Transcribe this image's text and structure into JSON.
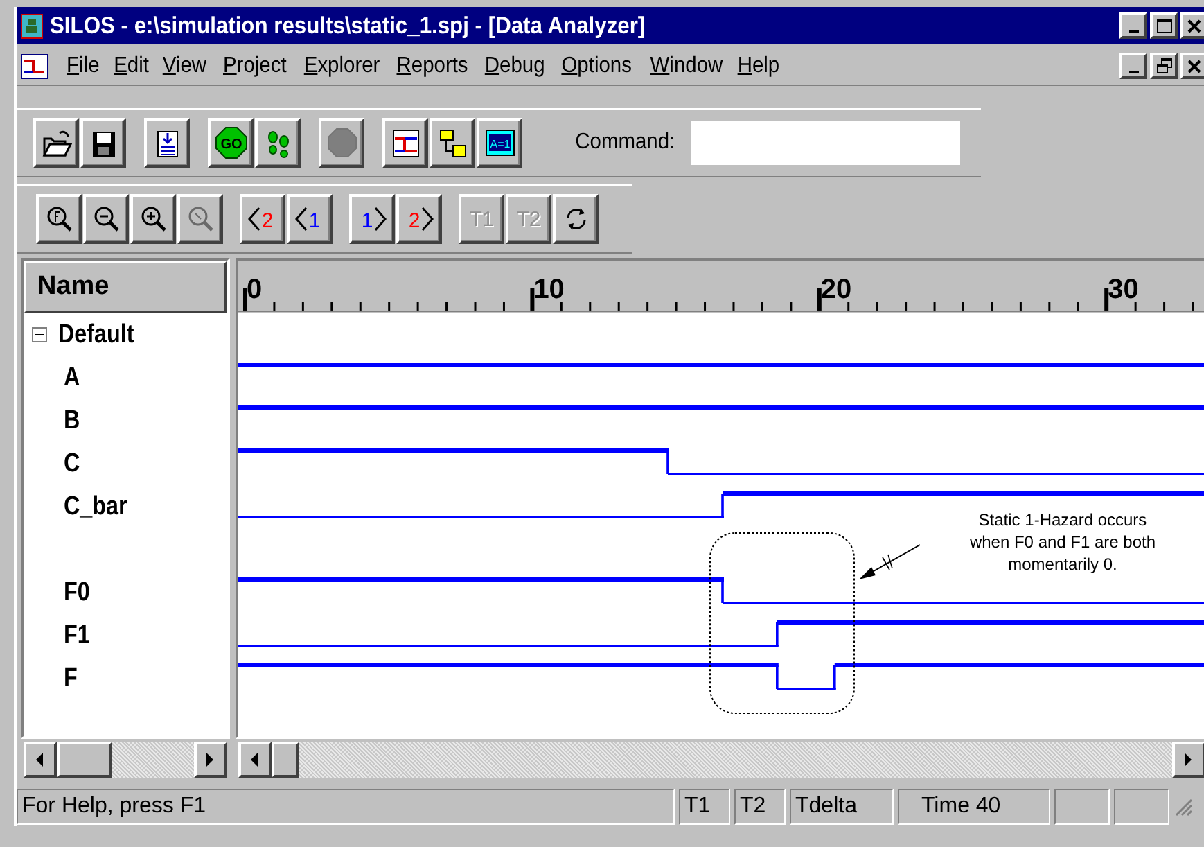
{
  "window": {
    "title": "SILOS - e:\\simulation results\\static_1.spj - [Data Analyzer]"
  },
  "menu": [
    "File",
    "Edit",
    "View",
    "Project",
    "Explorer",
    "Reports",
    "Debug",
    "Options",
    "Window",
    "Help"
  ],
  "toolbar": {
    "groups": [
      [
        {
          "kind": "open",
          "disabled": false
        },
        {
          "kind": "save",
          "disabled": false
        }
      ],
      [
        {
          "kind": "load",
          "disabled": false
        }
      ],
      [
        {
          "kind": "go",
          "label": "GO",
          "disabled": false
        },
        {
          "kind": "step",
          "disabled": false
        }
      ],
      [
        {
          "kind": "stop",
          "disabled": true
        }
      ],
      [
        {
          "kind": "wave",
          "disabled": false
        },
        {
          "kind": "hierarchy",
          "disabled": false
        },
        {
          "kind": "assign",
          "label": "A=1",
          "disabled": false
        }
      ]
    ],
    "command": {
      "label": "Command:"
    }
  },
  "nav_toolbar": {
    "groups": [
      [
        {
          "kind": "zoom-full",
          "disabled": false
        },
        {
          "kind": "zoom-out",
          "disabled": false
        },
        {
          "kind": "zoom-in",
          "disabled": false
        },
        {
          "kind": "zoom-area",
          "disabled": true
        }
      ],
      [
        {
          "kind": "prev",
          "label": "2",
          "color": "#ff0000",
          "disabled": false
        },
        {
          "kind": "prev",
          "label": "1",
          "color": "#0000ff",
          "disabled": false
        }
      ],
      [
        {
          "kind": "next",
          "label": "1",
          "color": "#0000ff",
          "disabled": false
        },
        {
          "kind": "next",
          "label": "2",
          "color": "#ff0000",
          "disabled": false
        }
      ],
      [
        {
          "kind": "text",
          "label": "T1",
          "disabled": true
        },
        {
          "kind": "text",
          "label": "T2",
          "disabled": true
        },
        {
          "kind": "refresh",
          "disabled": false
        }
      ]
    ]
  },
  "name_header": "Name",
  "ruler": {
    "labels": [
      "0",
      "10",
      "20",
      "30"
    ]
  },
  "signals": [
    {
      "kind": "group",
      "name": "Default",
      "expanded": true
    },
    {
      "kind": "signal",
      "name": "A",
      "high": true
    },
    {
      "kind": "signal",
      "name": "B",
      "high": true
    },
    {
      "kind": "signal",
      "name": "C",
      "high": true
    },
    {
      "kind": "signal",
      "name": "C_bar",
      "high": false
    },
    {
      "kind": "spacer"
    },
    {
      "kind": "signal",
      "name": "F0",
      "high": true
    },
    {
      "kind": "signal",
      "name": "F1",
      "high": false
    },
    {
      "kind": "signal",
      "name": "F",
      "high": true
    }
  ],
  "annotation": {
    "text": "Static 1-Hazard occurs when F0 and F1 are both momentarily 0."
  },
  "status_bar": [
    "For Help, press F1",
    "T1",
    "T2",
    "Tdelta",
    "Time 40"
  ]
}
